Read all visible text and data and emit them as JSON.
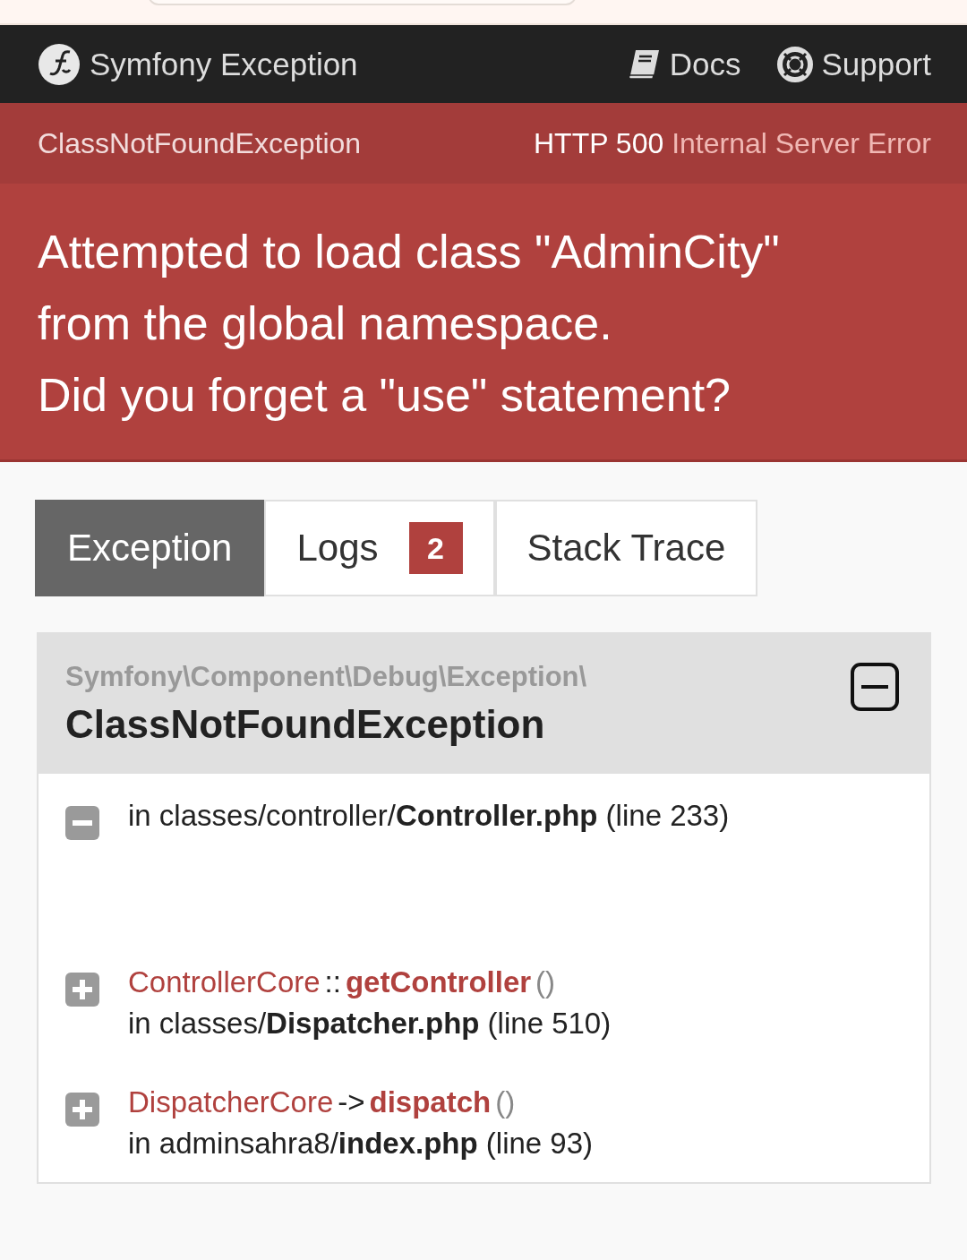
{
  "header": {
    "title": "Symfony Exception",
    "links": [
      {
        "kind": "docs",
        "label": "Docs"
      },
      {
        "kind": "support",
        "label": "Support"
      }
    ]
  },
  "status_bar": {
    "exception": "ClassNotFoundException",
    "code": "HTTP 500",
    "text": "Internal Server Error"
  },
  "message_lines": [
    "Attempted to load class \"AdminCity\"",
    "from the global namespace.",
    "Did you forget a \"use\" statement?"
  ],
  "tabs": [
    {
      "label": "Exception",
      "selected": true
    },
    {
      "label": "Logs",
      "selected": false,
      "badge": "2"
    },
    {
      "label": "Stack Trace",
      "selected": false
    }
  ],
  "exception": {
    "namespace": "Symfony\\Component\\Debug\\Exception\\",
    "class": "ClassNotFoundException",
    "expanded": true,
    "traces": [
      {
        "expanded": true,
        "location": "in classes/controller/**Controller.php** (line 233)"
      },
      {
        "expanded": false,
        "class": "ControllerCore",
        "call_type": "::",
        "function": "getController",
        "args": "()",
        "location": "in classes/**Dispatcher.php** (line 510)"
      },
      {
        "expanded": false,
        "class": "DispatcherCore",
        "call_type": "->",
        "function": "dispatch",
        "args": "()",
        "location": "in adminsahra8/**index.php** (line 93)"
      }
    ]
  }
}
